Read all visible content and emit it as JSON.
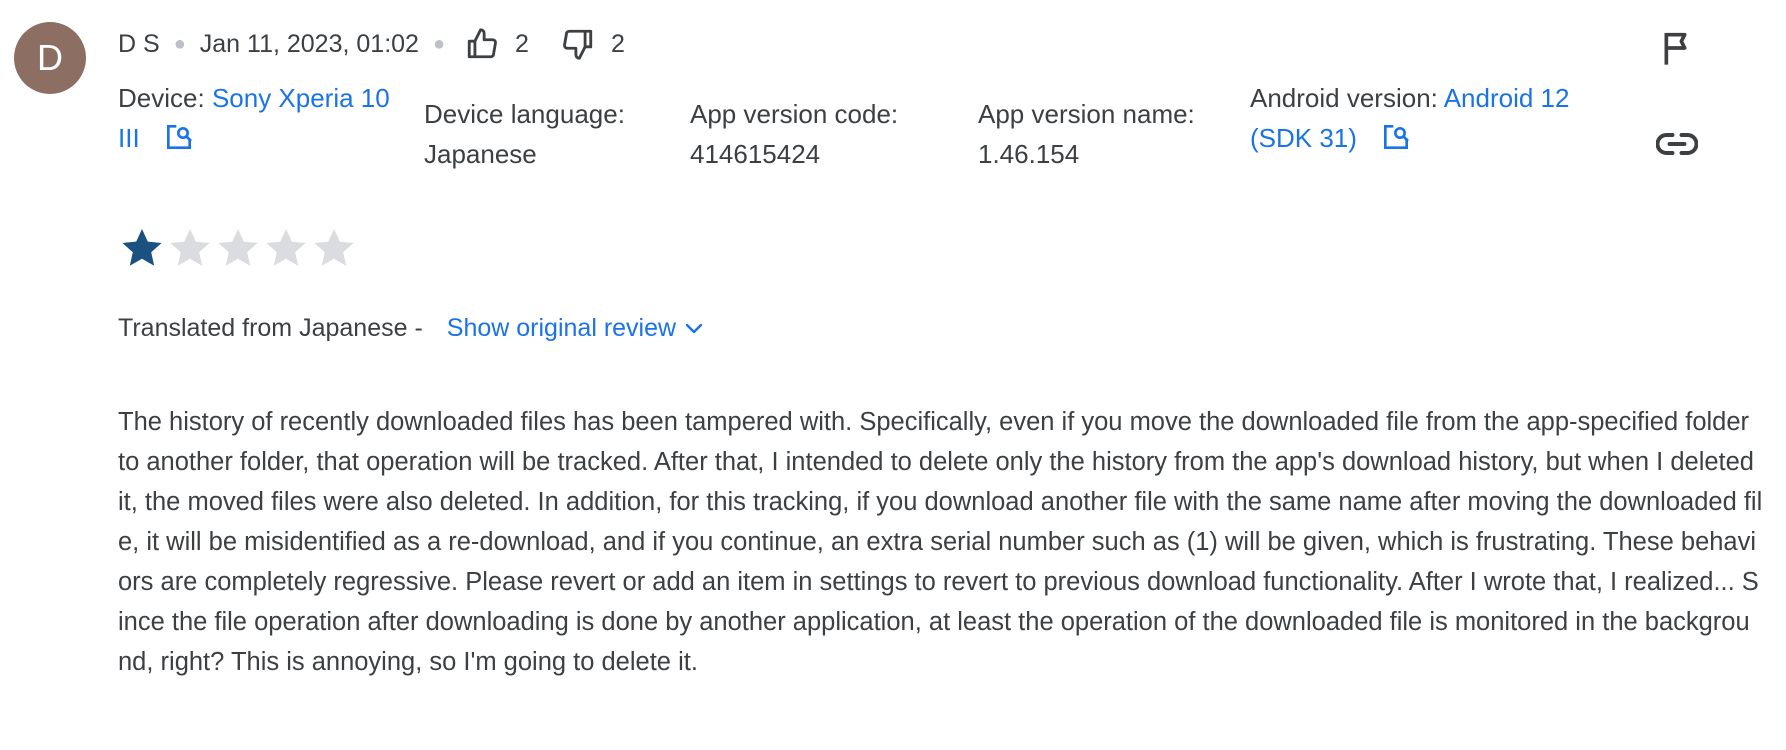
{
  "author": {
    "avatar_letter": "D",
    "avatar_color": "#8d6e63",
    "name": "D S",
    "date": "Jan 11, 2023, 01:02"
  },
  "votes": {
    "thumbs_up_count": "2",
    "thumbs_down_count": "2"
  },
  "device": {
    "device_label": "Device:",
    "device_value": "Sony Xperia 10 III",
    "language_label": "Device language:",
    "language_value": "Japanese",
    "version_code_label": "App version code:",
    "version_code_value": "414615424",
    "version_name_label": "App version name:",
    "version_name_value": "1.46.154",
    "android_label": "Android version:",
    "android_value": "Android 12 (SDK 31)"
  },
  "rating": {
    "stars": 1,
    "max_stars": 5,
    "filled_color": "#1a5180",
    "empty_color": "#dadce0"
  },
  "translation": {
    "translated_text": "Translated from Japanese -",
    "show_original_label": "Show original review"
  },
  "review_text": "The history of recently downloaded files has been tampered with. Specifically, even if you move the downloaded file from the app-specified folder to another folder, that operation will be tracked. After that, I intended to delete only the history from the app's download history, but when I deleted it, the moved files were also deleted. In addition, for this tracking, if you download another file with the same name after moving the downloaded file, it will be misidentified as a re-download, and if you continue, an extra serial number such as (1) will be given, which is frustrating. These behaviors are completely regressive. Please revert or add an item in settings to revert to previous download functionality. After I wrote that, I realized... Since the file operation after downloading is done by another application, at least the operation of the downloaded file is monitored in the background, right? This is annoying, so I'm going to delete it.",
  "icons": {
    "flag": "flag-icon",
    "link": "link-icon",
    "thumbs_up": "thumbs-up-icon",
    "thumbs_down": "thumbs-down-icon",
    "external": "open-in-search-icon",
    "chevron": "chevron-down-icon"
  },
  "colors": {
    "link": "#1a73e8",
    "text": "#3c4043"
  }
}
